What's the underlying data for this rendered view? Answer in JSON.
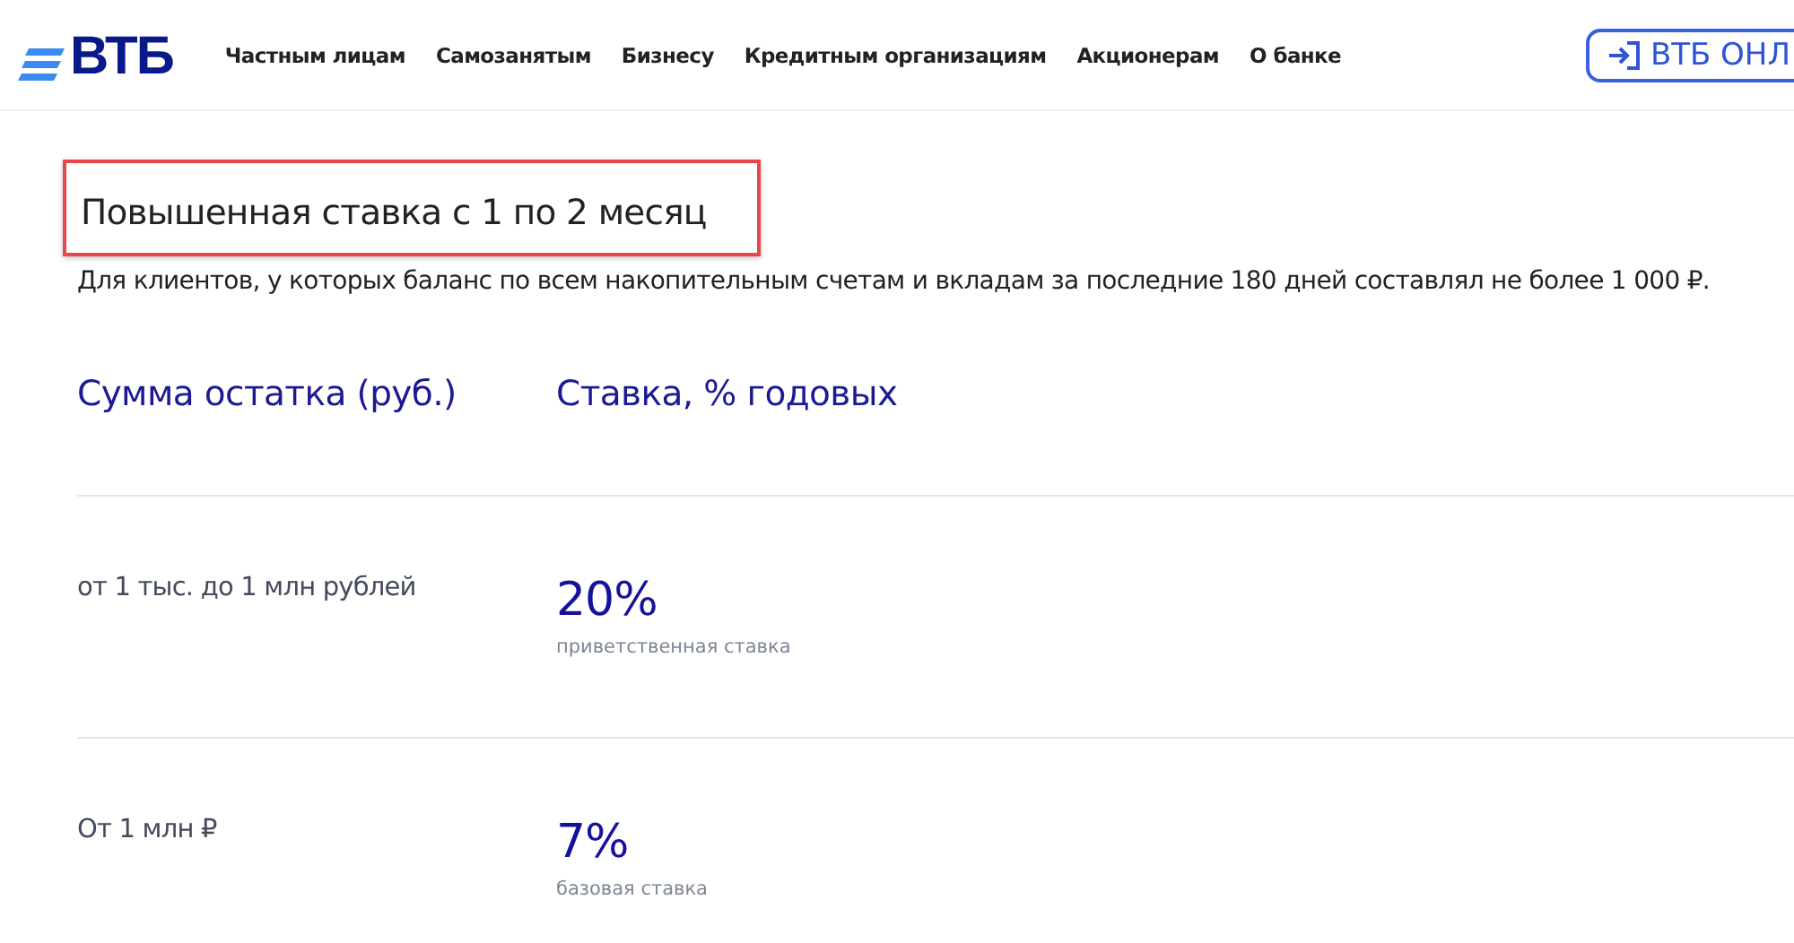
{
  "header": {
    "logo": "ВТБ",
    "nav": [
      "Частным лицам",
      "Самозанятым",
      "Бизнесу",
      "Кредитным организациям",
      "Акционерам",
      "О банке"
    ],
    "login_button": "ВТБ ОНЛ"
  },
  "section": {
    "title": "Повышенная ставка с 1 по 2 месяц",
    "title_highlighted": true,
    "description": "Для клиентов, у которых баланс по всем накопительным счетам и вкладам за последние 180 дней составлял не более 1 000 ₽.",
    "table": {
      "columns": [
        "Сумма остатка (руб.)",
        "Ставка, % годовых"
      ],
      "rows": [
        {
          "amount": "от 1 тыс. до 1 млн рублей",
          "rate": "20%",
          "note": "приветственная ставка"
        },
        {
          "amount": "От 1 млн ₽",
          "rate": "7%",
          "note": "базовая ставка"
        }
      ]
    }
  }
}
